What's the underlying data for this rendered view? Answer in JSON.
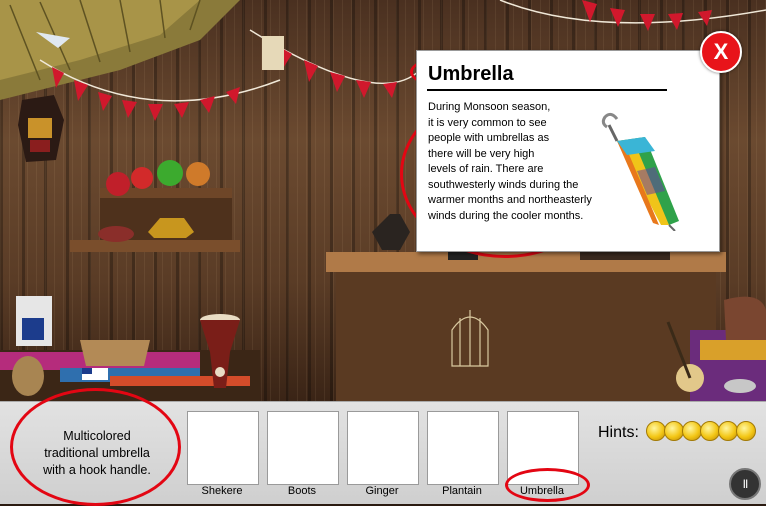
{
  "info_card": {
    "title": "Umbrella",
    "lines": [
      "During Monsoon season,",
      "it is very common to see",
      "people with umbrellas as",
      "there will be very high",
      "levels of rain. There are",
      "southwesterly winds during the",
      "warmer months and northeasterly",
      "winds during the cooler months."
    ],
    "close_label": "X",
    "image_icon": "umbrella-icon"
  },
  "clue": {
    "lines": [
      "Multicolored",
      "traditional umbrella",
      "with a hook handle."
    ]
  },
  "items": [
    {
      "label": "Shekere"
    },
    {
      "label": "Boots"
    },
    {
      "label": "Ginger"
    },
    {
      "label": "Plantain"
    },
    {
      "label": "Umbrella"
    }
  ],
  "hints": {
    "label": "Hints:",
    "remaining": 6
  },
  "pause": {
    "icon": "pause-icon",
    "label": "II"
  },
  "colors": {
    "annotation_red": "#e30613",
    "close_red": "#e8141a",
    "bunting_red": "#d0182c",
    "coin_gold": "#f3c614"
  }
}
